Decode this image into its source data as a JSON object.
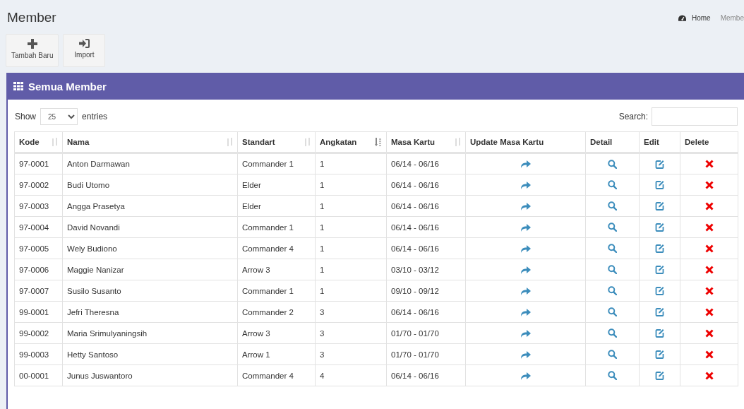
{
  "page_title": "Member",
  "breadcrumb": [
    "Home",
    "Membe"
  ],
  "toolbar": [
    {
      "kind": "add",
      "label": "Tambah Baru"
    },
    {
      "kind": "import",
      "label": "Import"
    }
  ],
  "box": {
    "title": "Semua Member",
    "show_label": "Show",
    "page_size": "25",
    "entries_label": "entries",
    "search_label": "Search:",
    "columns": [
      {
        "label": "Kode",
        "sortable": true,
        "sorted": false
      },
      {
        "label": "Nama",
        "sortable": true,
        "sorted": false
      },
      {
        "label": "Standart",
        "sortable": true,
        "sorted": false
      },
      {
        "label": "Angkatan",
        "sortable": true,
        "sorted": true
      },
      {
        "label": "Masa Kartu",
        "sortable": true,
        "sorted": false
      },
      {
        "label": "Update Masa Kartu",
        "sortable": false
      },
      {
        "label": "Detail",
        "sortable": false
      },
      {
        "label": "Edit",
        "sortable": false
      },
      {
        "label": "Delete",
        "sortable": false
      }
    ],
    "rows": [
      [
        "97-0001",
        "Anton Darmawan",
        "Commander 1",
        "1",
        "06/14 - 06/16"
      ],
      [
        "97-0002",
        "Budi Utomo",
        "Elder",
        "1",
        "06/14 - 06/16"
      ],
      [
        "97-0003",
        "Angga Prasetya",
        "Elder",
        "1",
        "06/14 - 06/16"
      ],
      [
        "97-0004",
        "David Novandi",
        "Commander 1",
        "1",
        "06/14 - 06/16"
      ],
      [
        "97-0005",
        "Wely Budiono",
        "Commander 4",
        "1",
        "06/14 - 06/16"
      ],
      [
        "97-0006",
        "Maggie Nanizar",
        "Arrow 3",
        "1",
        "03/10 - 03/12"
      ],
      [
        "97-0007",
        "Susilo Susanto",
        "Commander 1",
        "1",
        "09/10 - 09/12"
      ],
      [
        "99-0001",
        "Jefri Theresna",
        "Commander 2",
        "3",
        "06/14 - 06/16"
      ],
      [
        "99-0002",
        "Maria Srimulyaningsih",
        "Arrow 3",
        "3",
        "01/70 - 01/70"
      ],
      [
        "99-0003",
        "Hetty Santoso",
        "Arrow 1",
        "3",
        "01/70 - 01/70"
      ],
      [
        "00-0001",
        "Junus Juswantoro",
        "Commander 4",
        "4",
        "06/14 - 06/16"
      ]
    ]
  }
}
